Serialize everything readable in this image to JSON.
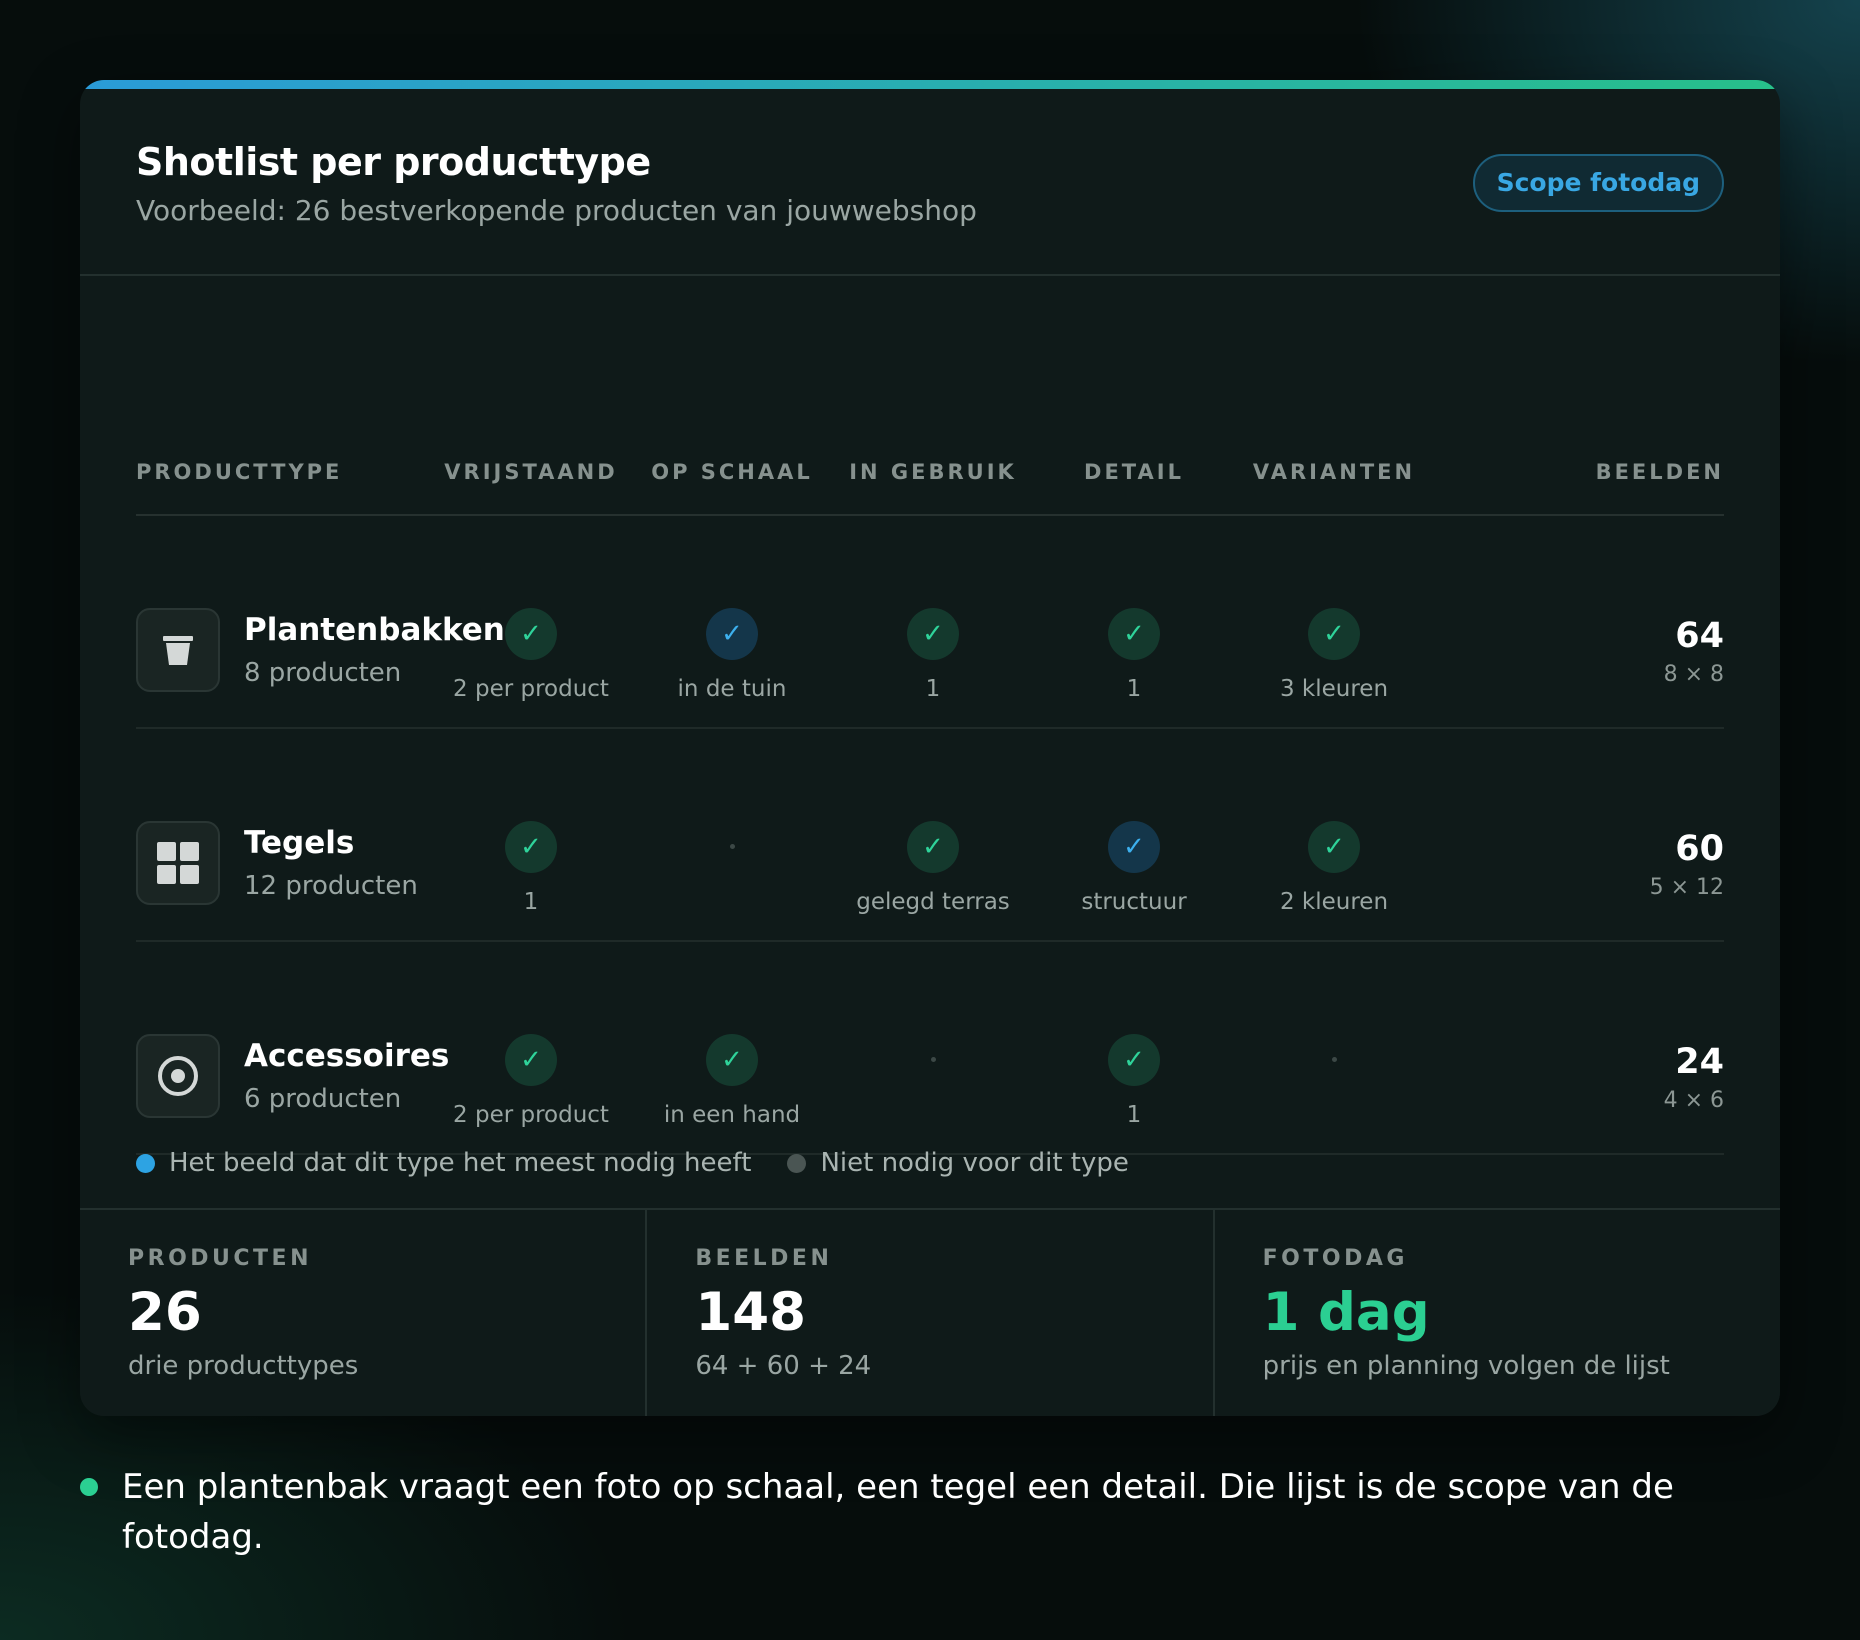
{
  "card": {
    "title": "Shotlist per producttype",
    "subtitle": "Voorbeeld: 26 bestverkopende producten van jouwwebshop",
    "scope_button": "Scope fotodag"
  },
  "colors": {
    "accent_green": "#2bcf92",
    "accent_blue": "#3db0ee",
    "muted_gray": "#4a5553"
  },
  "table": {
    "headers": {
      "producttype": "PRODUCTTYPE",
      "vrijstaand": "VRIJSTAAND",
      "op_schaal": "OP SCHAAL",
      "in_gebruik": "IN GEBRUIK",
      "detail": "DETAIL",
      "varianten": "VARIANTEN",
      "beelden": "BEELDEN"
    },
    "rows": [
      {
        "name": "Plantenbakken",
        "count": "8 producten",
        "icon": "planter-pot-icon",
        "vrijstaand": {
          "check": "✓",
          "style": "green",
          "label": "2 per product"
        },
        "op_schaal": {
          "check": "✓",
          "style": "blue",
          "label": "in de tuin"
        },
        "in_gebruik": {
          "check": "✓",
          "style": "green",
          "label": "1"
        },
        "detail": {
          "check": "✓",
          "style": "green",
          "label": "1"
        },
        "varianten": {
          "check": "✓",
          "style": "green",
          "label": "3 kleuren"
        },
        "beelden": "64",
        "formula": "8 × 8"
      },
      {
        "name": "Tegels",
        "count": "12 producten",
        "icon": "tiles-grid-icon",
        "vrijstaand": {
          "check": "✓",
          "style": "green",
          "label": "1"
        },
        "op_schaal": {
          "check": "",
          "style": "none",
          "label": ""
        },
        "in_gebruik": {
          "check": "✓",
          "style": "green",
          "label": "gelegd terras"
        },
        "detail": {
          "check": "✓",
          "style": "blue",
          "label": "structuur"
        },
        "varianten": {
          "check": "✓",
          "style": "green",
          "label": "2 kleuren"
        },
        "beelden": "60",
        "formula": "5 × 12"
      },
      {
        "name": "Accessoires",
        "count": "6 producten",
        "icon": "target-icon",
        "vrijstaand": {
          "check": "✓",
          "style": "green",
          "label": "2 per product"
        },
        "op_schaal": {
          "check": "✓",
          "style": "green",
          "label": "in een hand"
        },
        "in_gebruik": {
          "check": "",
          "style": "none",
          "label": ""
        },
        "detail": {
          "check": "✓",
          "style": "green",
          "label": "1"
        },
        "varianten": {
          "check": "",
          "style": "none",
          "label": ""
        },
        "beelden": "24",
        "formula": "4 × 6"
      }
    ]
  },
  "legend": {
    "primary": "Het beeld dat dit type het meest nodig heeft",
    "not_needed": "Niet nodig voor dit type"
  },
  "stats": {
    "producten": {
      "label": "PRODUCTEN",
      "value": "26",
      "sub": "drie producttypes"
    },
    "beelden": {
      "label": "BEELDEN",
      "value": "148",
      "sub": "64 + 60 + 24"
    },
    "fotodag": {
      "label": "FOTODAG",
      "value": "1 dag",
      "sub": "prijs en planning volgen de lijst"
    }
  },
  "note": "Een plantenbak vraagt een foto op schaal, een tegel een detail. Die lijst is de scope van de fotodag."
}
